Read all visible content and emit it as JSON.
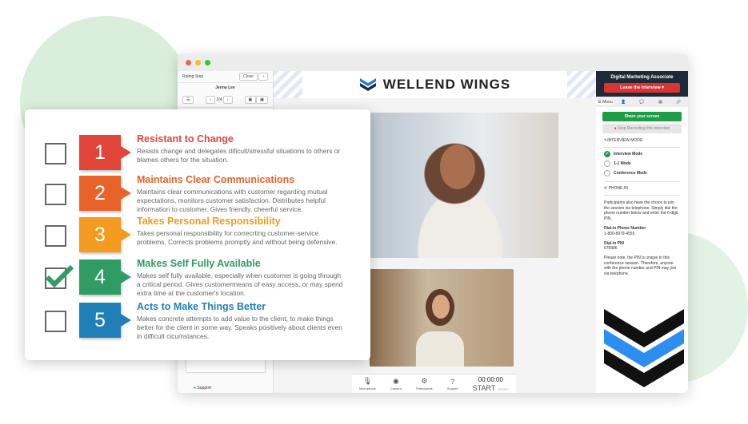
{
  "window": {
    "left_panel": {
      "title": "Rating Step",
      "close": "Close",
      "candidate": "Jenna Lee",
      "pager": "2/4",
      "support": "Support"
    },
    "header": {
      "logo": "WELLEND WINGS"
    },
    "toolbar": {
      "microphone": "Microphone",
      "camera": "Camera",
      "participants": "Participants",
      "support": "Support",
      "timer": "00:00:00",
      "start": "START",
      "reset": "RESET"
    },
    "right_panel": {
      "job_title": "Digital Marketing Associate",
      "leave": "Leave the Interview ▾",
      "tab_menu": "Menu",
      "share": "Share your screen",
      "stop": "Stop Recording this Interview",
      "mode_heading": "INTERVIEW MODE",
      "modes": [
        {
          "label": "Interview Mode",
          "selected": true
        },
        {
          "label": "1-1 Mode",
          "selected": false
        },
        {
          "label": "Conference Mode",
          "selected": false
        }
      ],
      "phone_heading": "PHONE-IN",
      "phone_intro": "Participants also have the choice to join the session via telephone. Simply dial the phone number below and enter the 6-digit PIN.",
      "dial_label": "Dial-in Phone Number",
      "dial_number": "1-800-8979-4555",
      "pin_label": "Dial-in PIN",
      "pin": "678986",
      "note": "Please note, the PIN is unique to this conference session. Therefore, anyone with the phone number and PIN may join via telephone."
    }
  },
  "rating_card": {
    "items": [
      {
        "number": "1",
        "title": "Resistant to Change",
        "desc": "Resists change and delegates dificult/stressful situations to others or blames others for the situation.",
        "color": "#e2453a",
        "checked": false
      },
      {
        "number": "2",
        "title": "Maintains Clear Communications",
        "desc": "Maintains clear communications with customer regarding mutual expectations, monitors customer satisfaction. Distributes helpful information to customer. Gives friendly, cheerful service.",
        "color": "#e8632a",
        "checked": false
      },
      {
        "number": "3",
        "title": "Takes Personal Responsibility",
        "desc": "Takes personal responsibility for correcrting customer-service problems. Corrects problems promptly and without being defensive.",
        "color": "#f29b1f",
        "checked": false
      },
      {
        "number": "4",
        "title": "Makes Self Fully Available",
        "desc": "Makes self fully available, especially when customer is going through a critical period. Gives customermeans of easy access, or may spend extra time at the customer's location.",
        "color": "#2e9c63",
        "checked": true
      },
      {
        "number": "5",
        "title": "Acts to Make Things Better",
        "desc": "Makes concrete attempts to add value to the client, to make things better for the client in some way. Speaks positively about clients even in difficult cicumstances.",
        "color": "#1f7fb6",
        "checked": false
      }
    ]
  }
}
